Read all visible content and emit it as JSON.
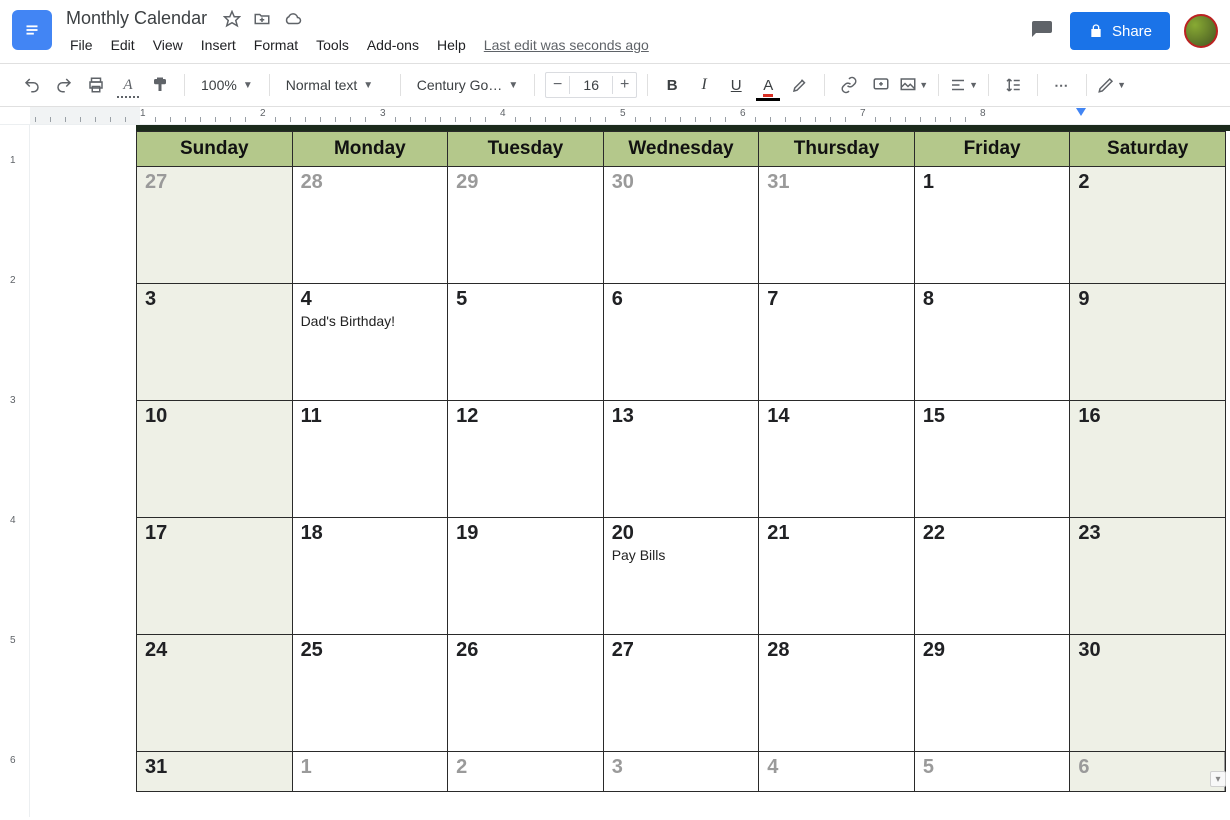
{
  "doc": {
    "title": "Monthly Calendar",
    "last_edit": "Last edit was seconds ago"
  },
  "menu": {
    "file": "File",
    "edit": "Edit",
    "view": "View",
    "insert": "Insert",
    "format": "Format",
    "tools": "Tools",
    "addons": "Add-ons",
    "help": "Help"
  },
  "share": {
    "label": "Share"
  },
  "toolbar": {
    "zoom": "100%",
    "style": "Normal text",
    "font": "Century Go…",
    "font_size": "16"
  },
  "ruler_h": [
    "1",
    "2",
    "3",
    "4",
    "5",
    "6",
    "7",
    "8"
  ],
  "ruler_v": [
    "1",
    "2",
    "3",
    "4",
    "5",
    "6"
  ],
  "calendar": {
    "days": [
      "Sunday",
      "Monday",
      "Tuesday",
      "Wednesday",
      "Thursday",
      "Friday",
      "Saturday"
    ],
    "rows": [
      [
        {
          "n": "27",
          "other": true,
          "weekend": true
        },
        {
          "n": "28",
          "other": true
        },
        {
          "n": "29",
          "other": true
        },
        {
          "n": "30",
          "other": true
        },
        {
          "n": "31",
          "other": true
        },
        {
          "n": "1"
        },
        {
          "n": "2",
          "weekend": true
        }
      ],
      [
        {
          "n": "3",
          "weekend": true
        },
        {
          "n": "4",
          "event": "Dad's Birthday!"
        },
        {
          "n": "5"
        },
        {
          "n": "6"
        },
        {
          "n": "7"
        },
        {
          "n": "8"
        },
        {
          "n": "9",
          "weekend": true
        }
      ],
      [
        {
          "n": "10",
          "weekend": true
        },
        {
          "n": "11"
        },
        {
          "n": "12"
        },
        {
          "n": "13"
        },
        {
          "n": "14"
        },
        {
          "n": "15"
        },
        {
          "n": "16",
          "weekend": true
        }
      ],
      [
        {
          "n": "17",
          "weekend": true
        },
        {
          "n": "18"
        },
        {
          "n": "19"
        },
        {
          "n": "20",
          "event": "Pay Bills"
        },
        {
          "n": "21"
        },
        {
          "n": "22"
        },
        {
          "n": "23",
          "weekend": true
        }
      ],
      [
        {
          "n": "24",
          "weekend": true
        },
        {
          "n": "25"
        },
        {
          "n": "26"
        },
        {
          "n": "27"
        },
        {
          "n": "28"
        },
        {
          "n": "29"
        },
        {
          "n": "30",
          "weekend": true
        }
      ],
      [
        {
          "n": "31",
          "weekend": true
        },
        {
          "n": "1",
          "other": true
        },
        {
          "n": "2",
          "other": true
        },
        {
          "n": "3",
          "other": true
        },
        {
          "n": "4",
          "other": true
        },
        {
          "n": "5",
          "other": true
        },
        {
          "n": "6",
          "other": true,
          "weekend": true,
          "cursor": true
        }
      ]
    ]
  }
}
